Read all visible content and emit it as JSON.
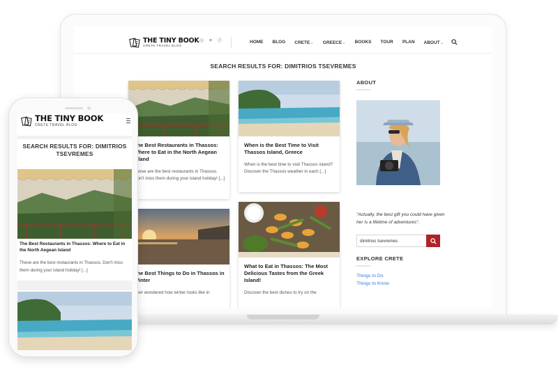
{
  "brand": {
    "title": "THE TINY BOOK",
    "subtitle": "CRETE TRAVEL BLOG"
  },
  "social_icons": [
    "facebook-icon",
    "instagram-icon",
    "twitter-icon",
    "pinterest-icon"
  ],
  "nav": {
    "items": [
      "HOME",
      "BLOG",
      "CRETE",
      "GREECE",
      "BOOKS",
      "TOUR",
      "PLAN",
      "ABOUT"
    ],
    "dropdown_marker": "⌄"
  },
  "search_results": {
    "title": "SEARCH RESULTS FOR: DIMITRIOS TSEVREMES",
    "mobile_title": "SEARCH RESULTS FOR: DIMITRIOS TSEVREMES"
  },
  "posts": [
    {
      "title": "The Best Restaurants in Thassos: Where to Eat in the North Aegean Island",
      "excerpt": "These are the best restaurants in Thassos. Don't miss them during your island holiday! [...]"
    },
    {
      "title": "When is the Best Time to Visit Thassos Island, Greece",
      "excerpt": "When is the best time to visit Thassos island? Discover the Thassos weather in each [...]"
    },
    {
      "title": "The Best Things to Do in Thassos in Winter",
      "excerpt": "Ever wondered how winter looks like in"
    },
    {
      "title": "What to Eat in Thassos: The Most Delicious Tastes from the Greek Island!",
      "excerpt": "Discover the best dishes to try on the"
    }
  ],
  "sidebar": {
    "about_heading": "ABOUT",
    "quote": "\"Actually, the best gift you could have given her is a lifetime of adventures\".",
    "search_value": "dimitrios tsevremes",
    "explore_heading": "EXPLORE CRETE",
    "links": [
      "Things to Do",
      "Things to Know"
    ]
  },
  "colors": {
    "accent_red": "#b2212a",
    "link_blue": "#3c76d1",
    "text_dark": "#222222"
  }
}
